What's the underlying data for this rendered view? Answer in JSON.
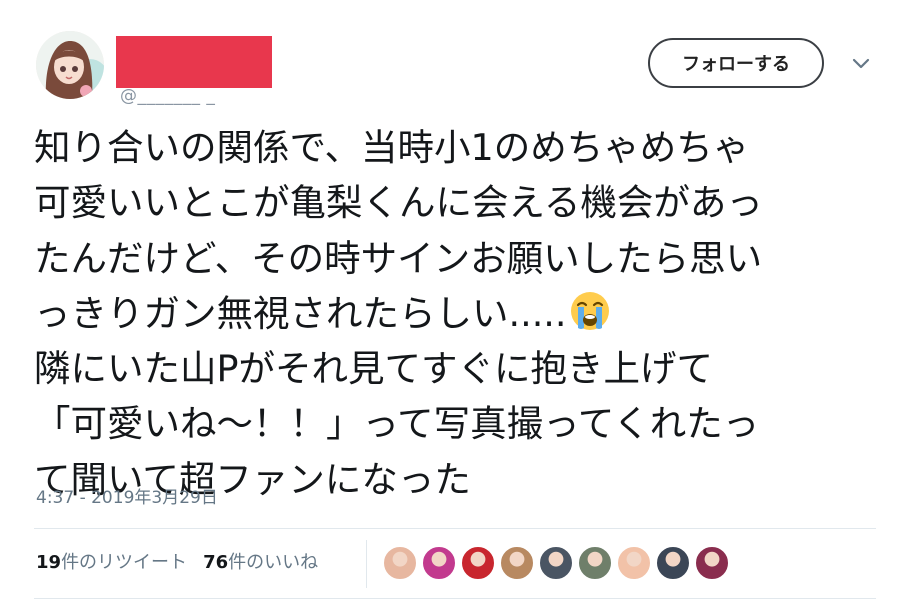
{
  "header": {
    "follow_label": "フォローする"
  },
  "tweet": {
    "text": "知り合いの関係で、当時小1のめちゃめちゃ\n可愛いいとこが亀梨くんに会える機会があっ\nたんだけど、その時サインお願いしたら思い\nっきりガン無視されたらしい.....",
    "emoji_name": "loudly-crying-face",
    "text_after": "\n隣にいた山Pがそれ見てすぐに抱き上げて\n「可愛いね～！！」って写真撮ってくれたっ\nて聞いて超ファンになった",
    "timestamp": "4:37 - 2019年3月29日"
  },
  "stats": {
    "retweet_count": "19",
    "retweet_label": "件のリツイート",
    "like_count": "76",
    "like_label": "件のいいね"
  },
  "likers": [
    {
      "name": "liker-avatar-1",
      "color": "#e7b7a0"
    },
    {
      "name": "liker-avatar-2",
      "color": "#c23a8e"
    },
    {
      "name": "liker-avatar-3",
      "color": "#c8262e"
    },
    {
      "name": "liker-avatar-4",
      "color": "#b88961"
    },
    {
      "name": "liker-avatar-5",
      "color": "#4a5563"
    },
    {
      "name": "liker-avatar-6",
      "color": "#6f7f6a"
    },
    {
      "name": "liker-avatar-7",
      "color": "#f2c2a8"
    },
    {
      "name": "liker-avatar-8",
      "color": "#3b4656"
    },
    {
      "name": "liker-avatar-9",
      "color": "#8a2d4e"
    }
  ],
  "colors": {
    "redaction": "#e8374d",
    "muted_text": "#657786",
    "divider": "#e1e8ed"
  }
}
